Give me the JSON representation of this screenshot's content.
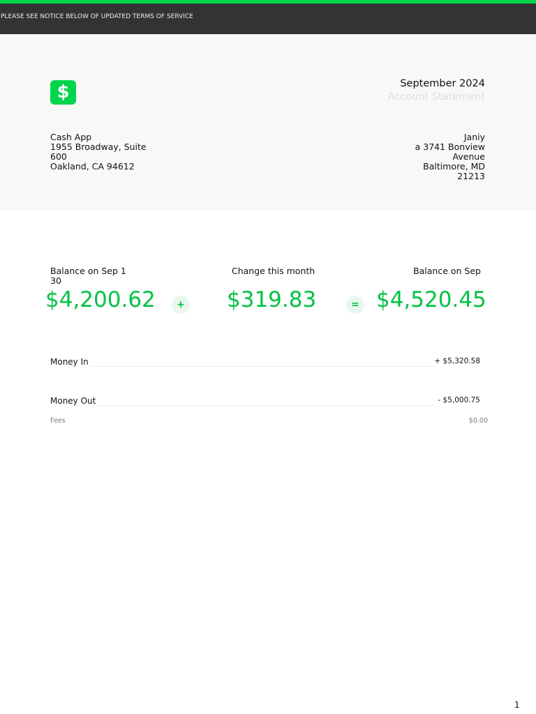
{
  "notice": "PLEASE SEE NOTICE BELOW OF UPDATED TERMS OF SERVICE",
  "logo_icon": "dollar-sign-icon",
  "logo_glyph": "$",
  "brand_color": "#00d54b",
  "period": "September 2024",
  "doc_title": "Account Statement",
  "sender": {
    "lines": [
      "Cash App",
      "1955 Broadway, Suite",
      "600",
      "Oakland, CA 94612"
    ]
  },
  "recipient": {
    "lines": [
      "Janiy",
      "a 3741 Bonview",
      "Avenue",
      "Baltimore, MD",
      "21213"
    ]
  },
  "summary": {
    "start_label": "Balance on Sep 1",
    "start_label_overflow": "30",
    "change_label": "Change this month",
    "end_label": "Balance on Sep",
    "start_amount": "$4,200.62",
    "plus": "+",
    "change_amount": "$319.83",
    "equals": "=",
    "end_amount": "$4,520.45"
  },
  "rows": [
    {
      "name": "Money In",
      "value": "+  $5,320.58"
    },
    {
      "name": "Money Out",
      "value": "- $5,000.75"
    }
  ],
  "fees": {
    "name": "Fees",
    "value": "$0.00"
  },
  "page_number": "1"
}
